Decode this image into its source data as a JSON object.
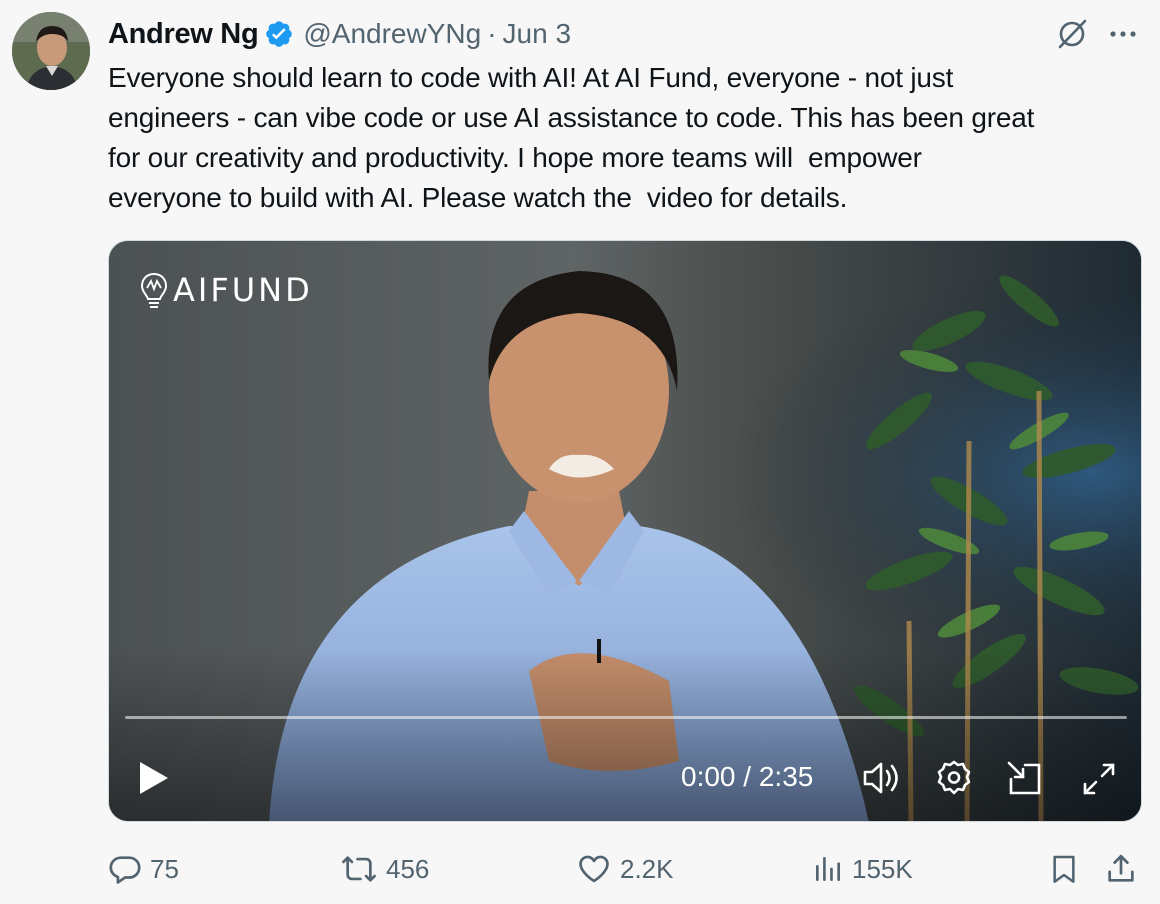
{
  "author": {
    "name": "Andrew Ng",
    "handle": "@AndrewYNg",
    "separator": "·",
    "date": "Jun 3",
    "verified": true,
    "verified_color": "#1d9bf0"
  },
  "tweet_text": [
    "Everyone should learn to code with AI! At AI Fund, everyone - not just",
    "engineers - can vibe code or use AI assistance to code. This has been great",
    "for our creativity and productivity. I hope more teams will  empower",
    "everyone to build with AI. Please watch the  video for details."
  ],
  "video": {
    "logo_text": "AIFUND",
    "current_time": "0:00",
    "duration": "2:35",
    "time_separator": " / ",
    "progress_fraction": 0.0,
    "controls": [
      "play-icon",
      "volume-icon",
      "settings-icon",
      "picture-in-picture-icon",
      "fullscreen-icon"
    ]
  },
  "actions": {
    "replies": "75",
    "reposts": "456",
    "likes": "2.2K",
    "views": "155K"
  },
  "icons": {
    "top_right": [
      "grok-icon",
      "more-icon"
    ],
    "action_bar": [
      "reply-icon",
      "repost-icon",
      "like-icon",
      "views-icon",
      "bookmark-icon",
      "share-icon"
    ]
  },
  "colors": {
    "text_primary": "#0f1419",
    "text_secondary": "#536471",
    "background": "#f7f7f7",
    "accent": "#1d9bf0"
  }
}
